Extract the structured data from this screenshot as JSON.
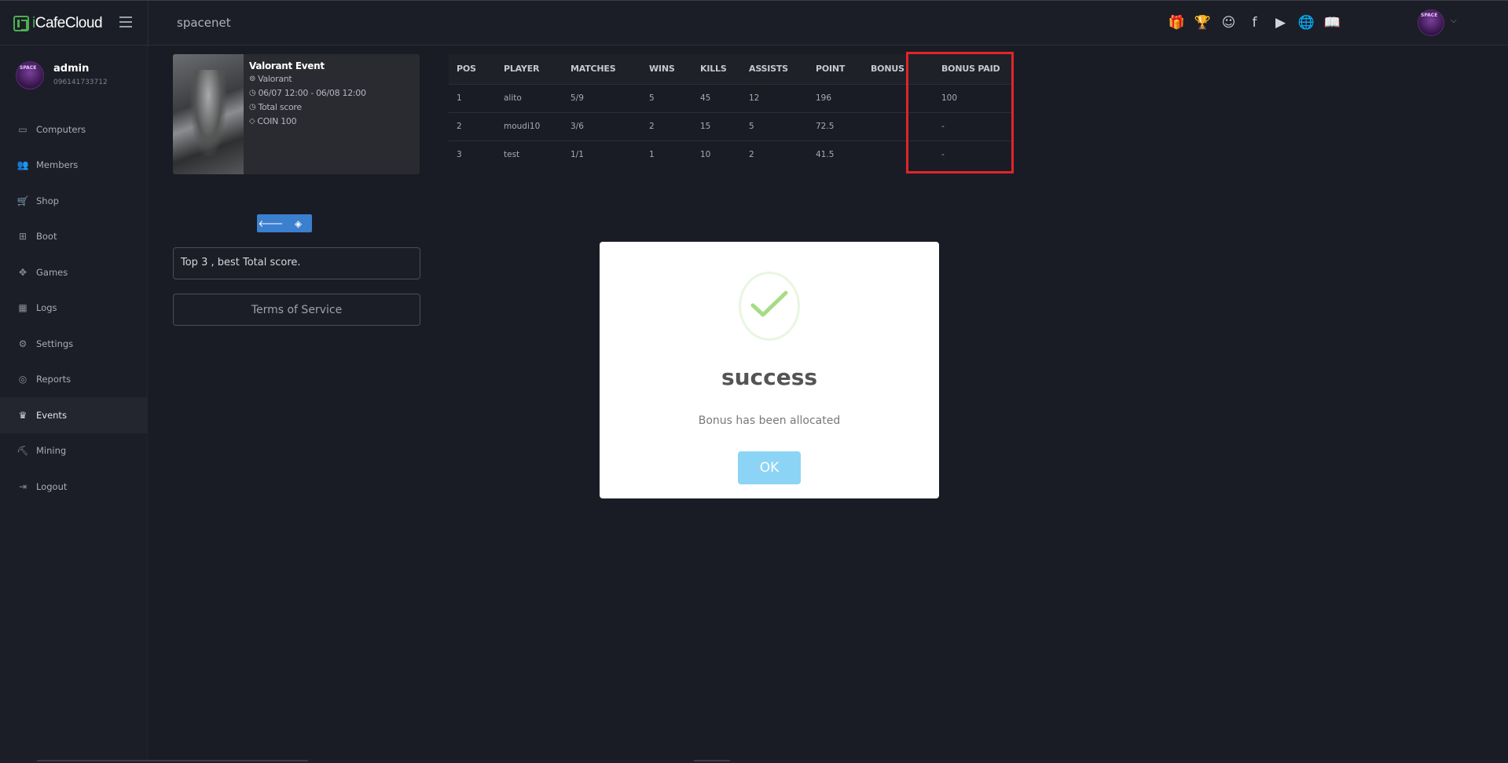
{
  "app": {
    "logo_i": "i",
    "logo_text": "CafeCloud",
    "site_name": "spacenet"
  },
  "top_icons": [
    {
      "name": "gift-icon",
      "glyph": "🎁"
    },
    {
      "name": "trophy-icon",
      "glyph": "🏆"
    },
    {
      "name": "discord-icon",
      "glyph": "☺"
    },
    {
      "name": "facebook-icon",
      "glyph": "f"
    },
    {
      "name": "youtube-icon",
      "glyph": "▶"
    },
    {
      "name": "globe-icon",
      "glyph": "🌐"
    },
    {
      "name": "book-icon",
      "glyph": "📖"
    }
  ],
  "user": {
    "name": "admin",
    "phone": "096141733712"
  },
  "menu": [
    {
      "label": "Computers",
      "icon": "monitor-icon",
      "glyph": "▭"
    },
    {
      "label": "Members",
      "icon": "members-icon",
      "glyph": "👥"
    },
    {
      "label": "Shop",
      "icon": "cart-icon",
      "glyph": "🛒"
    },
    {
      "label": "Boot",
      "icon": "windows-icon",
      "glyph": "⊞"
    },
    {
      "label": "Games",
      "icon": "gamepad-icon",
      "glyph": "✥"
    },
    {
      "label": "Logs",
      "icon": "calendar-icon",
      "glyph": "▦"
    },
    {
      "label": "Settings",
      "icon": "settings-icon",
      "glyph": "⚙"
    },
    {
      "label": "Reports",
      "icon": "reports-icon",
      "glyph": "◎"
    },
    {
      "label": "Events",
      "icon": "crown-icon",
      "glyph": "♛"
    },
    {
      "label": "Mining",
      "icon": "pickaxe-icon",
      "glyph": "⛏"
    },
    {
      "label": "Logout",
      "icon": "logout-icon",
      "glyph": "⇥"
    }
  ],
  "active_menu": "Events",
  "event": {
    "title": "Valorant Event",
    "game": "Valorant",
    "period": "06/07 12:00 - 06/08 12:00",
    "scoring": "Total score",
    "reward": "COIN 100",
    "description": "Top 3 , best Total score.",
    "terms": "Terms of Service"
  },
  "table": {
    "headers": [
      "POS",
      "PLAYER",
      "MATCHES",
      "WINS",
      "KILLS",
      "ASSISTS",
      "POINT",
      "BONUS",
      "BONUS PAID"
    ],
    "rows": [
      [
        "1",
        "alito",
        "5/9",
        "5",
        "45",
        "12",
        "196",
        "",
        "100"
      ],
      [
        "2",
        "moudi10",
        "3/6",
        "2",
        "15",
        "5",
        "72.5",
        "",
        "-"
      ],
      [
        "3",
        "test",
        "1/1",
        "1",
        "10",
        "2",
        "41.5",
        "",
        "-"
      ]
    ]
  },
  "modal": {
    "title": "success",
    "message": "Bonus has been allocated",
    "ok_label": "OK"
  }
}
